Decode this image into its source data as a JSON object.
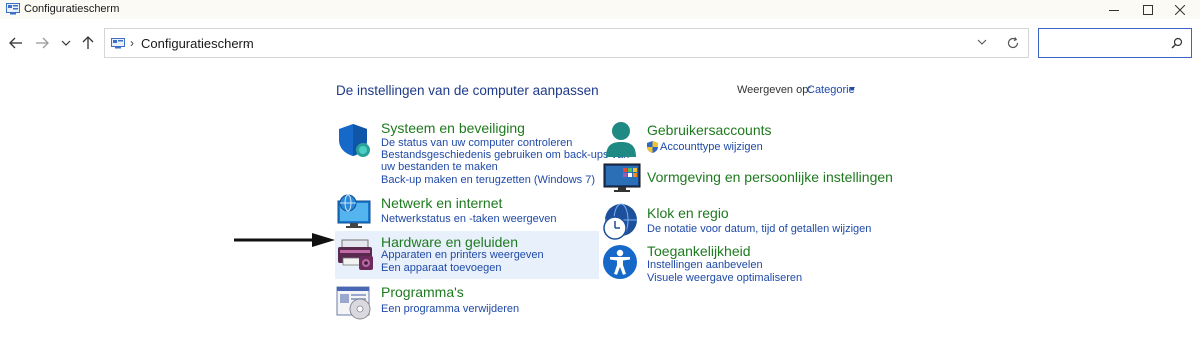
{
  "window": {
    "title": "Configuratiescherm"
  },
  "address": {
    "crumb": "Configuratiescherm",
    "search_placeholder": ""
  },
  "main": {
    "title": "De instellingen van de computer aanpassen",
    "view_by_label": "Weergeven op:",
    "view_by_value": "Categorie"
  },
  "categories_left": [
    {
      "title": "Systeem en beveiliging",
      "links": [
        "De status van uw computer controleren",
        "Bestandsgeschiedenis gebruiken om back-ups van",
        "uw bestanden te maken",
        "Back-up maken en terugzetten (Windows 7)"
      ]
    },
    {
      "title": "Netwerk en internet",
      "links": [
        "Netwerkstatus en -taken weergeven"
      ]
    },
    {
      "title": "Hardware en geluiden",
      "links": [
        "Apparaten en printers weergeven",
        "Een apparaat toevoegen"
      ]
    },
    {
      "title": "Programma's",
      "links": [
        "Een programma verwijderen"
      ]
    }
  ],
  "categories_right": [
    {
      "title": "Gebruikersaccounts",
      "links": [
        "Accounttype wijzigen"
      ]
    },
    {
      "title": "Vormgeving en persoonlijke instellingen",
      "links": []
    },
    {
      "title": "Klok en regio",
      "links": [
        "De notatie voor datum, tijd of getallen wijzigen"
      ]
    },
    {
      "title": "Toegankelijkheid",
      "links": [
        "Instellingen aanbevelen",
        "Visuele weergave optimaliseren"
      ]
    }
  ],
  "colors": {
    "heading_green": "#1e7a1e",
    "link_blue": "#1f4aa8",
    "title_blue": "#1e3a8a",
    "highlight": "#e8f1fb"
  },
  "icons": {
    "system": "shield-icon",
    "network": "globe-monitor-icon",
    "hardware": "printer-icon",
    "programs": "programs-icon",
    "users": "user-icon",
    "appearance": "monitor-icon",
    "clock": "clock-globe-icon",
    "accessibility": "accessibility-icon"
  }
}
